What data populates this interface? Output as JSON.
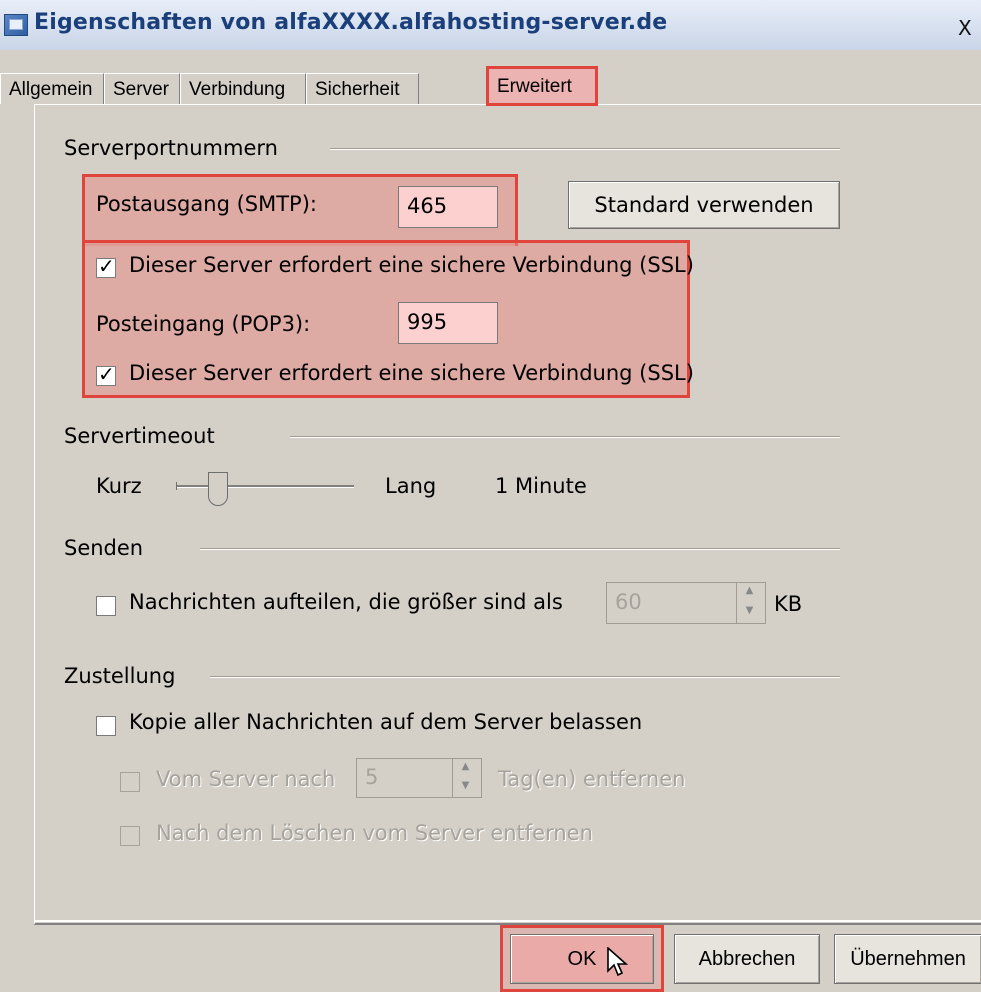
{
  "window": {
    "title": "Eigenschaften von alfaXXXX.alfahosting-server.de",
    "close_glyph": "X"
  },
  "tabs": [
    {
      "label": "Allgemein"
    },
    {
      "label": "Server"
    },
    {
      "label": "Verbindung"
    },
    {
      "label": "Sicherheit"
    },
    {
      "label": "Erweitert",
      "active": true
    }
  ],
  "serverports": {
    "heading": "Serverportnummern",
    "smtp_label": "Postausgang (SMTP):",
    "smtp_value": "465",
    "default_button": "Standard verwenden",
    "ssl_smtp_label": "Dieser Server erfordert eine sichere Verbindung (SSL)",
    "pop3_label": "Posteingang (POP3):",
    "pop3_value": "995",
    "ssl_pop3_label": "Dieser Server erfordert eine sichere Verbindung (SSL)"
  },
  "timeout": {
    "heading": "Servertimeout",
    "short_label": "Kurz",
    "long_label": "Lang",
    "value_text": "1 Minute",
    "level": 0.2
  },
  "send": {
    "heading": "Senden",
    "split_label": "Nachrichten aufteilen, die größer sind als",
    "split_value": "60",
    "unit": "KB"
  },
  "delivery": {
    "heading": "Zustellung",
    "keep_copy_label": "Kopie aller Nachrichten auf dem Server belassen",
    "remove_after_prefix": "Vom Server nach",
    "remove_after_value": "5",
    "remove_after_suffix": "Tag(en) entfernen",
    "remove_on_delete_label": "Nach dem Löschen vom Server entfernen"
  },
  "buttons": {
    "ok": "OK",
    "cancel": "Abbrechen",
    "apply": "Übernehmen"
  },
  "colors": {
    "highlight_border": "#e0453d",
    "highlight_fill": "#ebb3b1",
    "dialog_bg": "#d4d0c8"
  }
}
